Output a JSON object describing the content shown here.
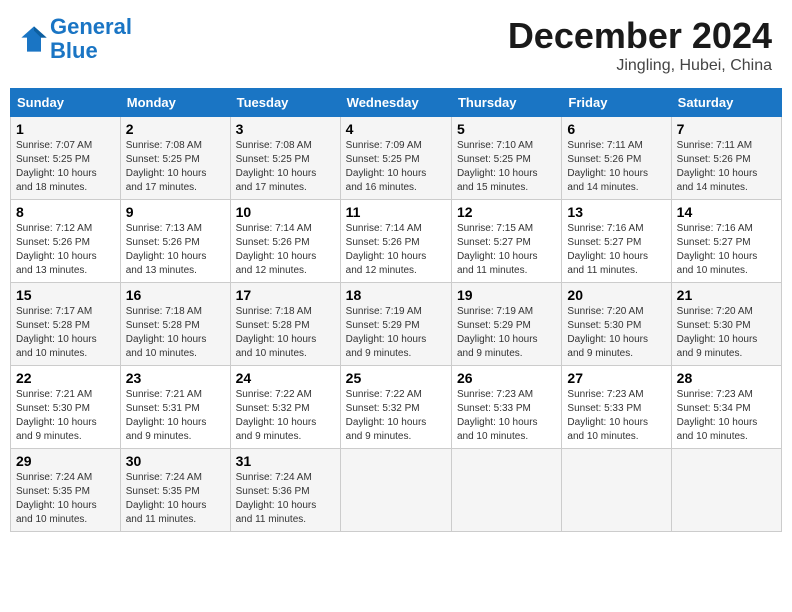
{
  "header": {
    "logo_line1": "General",
    "logo_line2": "Blue",
    "month": "December 2024",
    "location": "Jingling, Hubei, China"
  },
  "weekdays": [
    "Sunday",
    "Monday",
    "Tuesday",
    "Wednesday",
    "Thursday",
    "Friday",
    "Saturday"
  ],
  "weeks": [
    [
      {
        "day": "1",
        "info": "Sunrise: 7:07 AM\nSunset: 5:25 PM\nDaylight: 10 hours\nand 18 minutes."
      },
      {
        "day": "2",
        "info": "Sunrise: 7:08 AM\nSunset: 5:25 PM\nDaylight: 10 hours\nand 17 minutes."
      },
      {
        "day": "3",
        "info": "Sunrise: 7:08 AM\nSunset: 5:25 PM\nDaylight: 10 hours\nand 17 minutes."
      },
      {
        "day": "4",
        "info": "Sunrise: 7:09 AM\nSunset: 5:25 PM\nDaylight: 10 hours\nand 16 minutes."
      },
      {
        "day": "5",
        "info": "Sunrise: 7:10 AM\nSunset: 5:25 PM\nDaylight: 10 hours\nand 15 minutes."
      },
      {
        "day": "6",
        "info": "Sunrise: 7:11 AM\nSunset: 5:26 PM\nDaylight: 10 hours\nand 14 minutes."
      },
      {
        "day": "7",
        "info": "Sunrise: 7:11 AM\nSunset: 5:26 PM\nDaylight: 10 hours\nand 14 minutes."
      }
    ],
    [
      {
        "day": "8",
        "info": "Sunrise: 7:12 AM\nSunset: 5:26 PM\nDaylight: 10 hours\nand 13 minutes."
      },
      {
        "day": "9",
        "info": "Sunrise: 7:13 AM\nSunset: 5:26 PM\nDaylight: 10 hours\nand 13 minutes."
      },
      {
        "day": "10",
        "info": "Sunrise: 7:14 AM\nSunset: 5:26 PM\nDaylight: 10 hours\nand 12 minutes."
      },
      {
        "day": "11",
        "info": "Sunrise: 7:14 AM\nSunset: 5:26 PM\nDaylight: 10 hours\nand 12 minutes."
      },
      {
        "day": "12",
        "info": "Sunrise: 7:15 AM\nSunset: 5:27 PM\nDaylight: 10 hours\nand 11 minutes."
      },
      {
        "day": "13",
        "info": "Sunrise: 7:16 AM\nSunset: 5:27 PM\nDaylight: 10 hours\nand 11 minutes."
      },
      {
        "day": "14",
        "info": "Sunrise: 7:16 AM\nSunset: 5:27 PM\nDaylight: 10 hours\nand 10 minutes."
      }
    ],
    [
      {
        "day": "15",
        "info": "Sunrise: 7:17 AM\nSunset: 5:28 PM\nDaylight: 10 hours\nand 10 minutes."
      },
      {
        "day": "16",
        "info": "Sunrise: 7:18 AM\nSunset: 5:28 PM\nDaylight: 10 hours\nand 10 minutes."
      },
      {
        "day": "17",
        "info": "Sunrise: 7:18 AM\nSunset: 5:28 PM\nDaylight: 10 hours\nand 10 minutes."
      },
      {
        "day": "18",
        "info": "Sunrise: 7:19 AM\nSunset: 5:29 PM\nDaylight: 10 hours\nand 9 minutes."
      },
      {
        "day": "19",
        "info": "Sunrise: 7:19 AM\nSunset: 5:29 PM\nDaylight: 10 hours\nand 9 minutes."
      },
      {
        "day": "20",
        "info": "Sunrise: 7:20 AM\nSunset: 5:30 PM\nDaylight: 10 hours\nand 9 minutes."
      },
      {
        "day": "21",
        "info": "Sunrise: 7:20 AM\nSunset: 5:30 PM\nDaylight: 10 hours\nand 9 minutes."
      }
    ],
    [
      {
        "day": "22",
        "info": "Sunrise: 7:21 AM\nSunset: 5:30 PM\nDaylight: 10 hours\nand 9 minutes."
      },
      {
        "day": "23",
        "info": "Sunrise: 7:21 AM\nSunset: 5:31 PM\nDaylight: 10 hours\nand 9 minutes."
      },
      {
        "day": "24",
        "info": "Sunrise: 7:22 AM\nSunset: 5:32 PM\nDaylight: 10 hours\nand 9 minutes."
      },
      {
        "day": "25",
        "info": "Sunrise: 7:22 AM\nSunset: 5:32 PM\nDaylight: 10 hours\nand 9 minutes."
      },
      {
        "day": "26",
        "info": "Sunrise: 7:23 AM\nSunset: 5:33 PM\nDaylight: 10 hours\nand 10 minutes."
      },
      {
        "day": "27",
        "info": "Sunrise: 7:23 AM\nSunset: 5:33 PM\nDaylight: 10 hours\nand 10 minutes."
      },
      {
        "day": "28",
        "info": "Sunrise: 7:23 AM\nSunset: 5:34 PM\nDaylight: 10 hours\nand 10 minutes."
      }
    ],
    [
      {
        "day": "29",
        "info": "Sunrise: 7:24 AM\nSunset: 5:35 PM\nDaylight: 10 hours\nand 10 minutes."
      },
      {
        "day": "30",
        "info": "Sunrise: 7:24 AM\nSunset: 5:35 PM\nDaylight: 10 hours\nand 11 minutes."
      },
      {
        "day": "31",
        "info": "Sunrise: 7:24 AM\nSunset: 5:36 PM\nDaylight: 10 hours\nand 11 minutes."
      },
      null,
      null,
      null,
      null
    ]
  ]
}
